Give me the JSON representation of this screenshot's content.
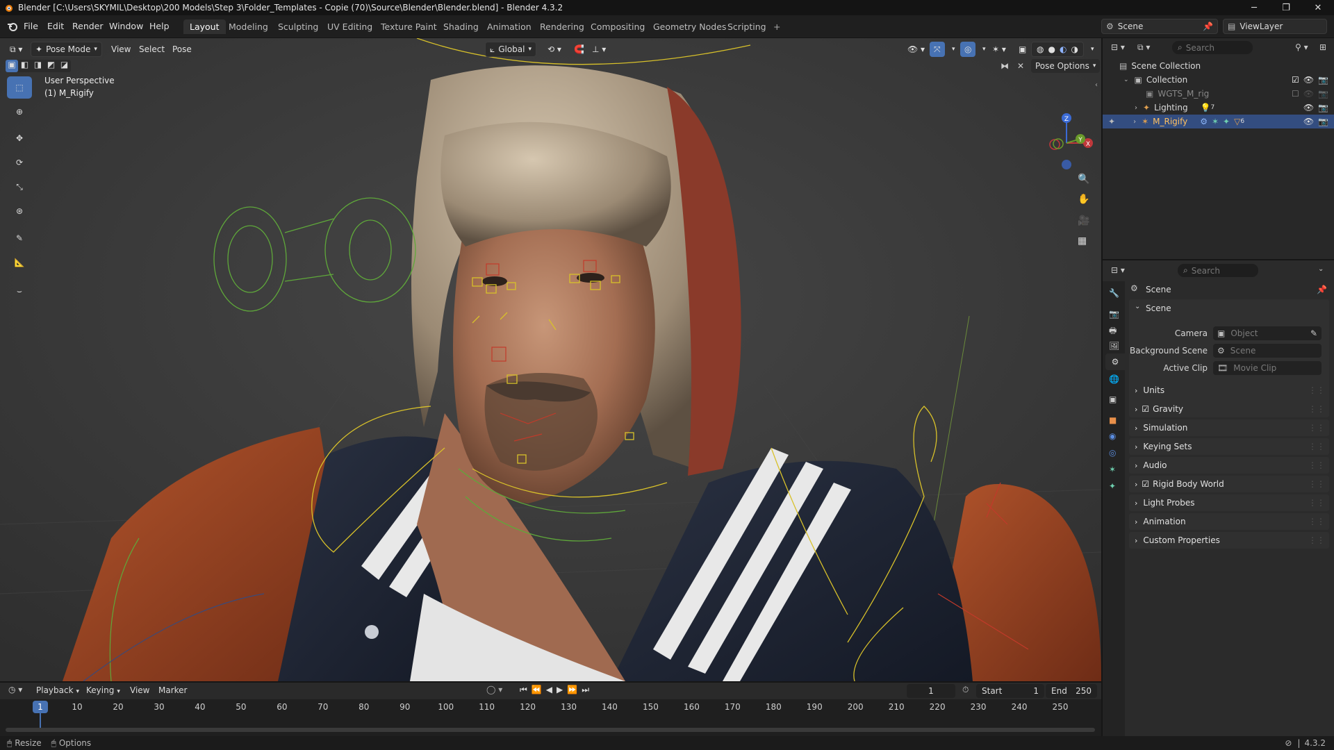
{
  "window": {
    "title": "Blender [C:\\Users\\SKYMIL\\Desktop\\200 Models\\Step 3\\Folder_Templates - Copie (70)\\Source\\Blender\\Blender.blend] - Blender 4.3.2"
  },
  "menu": [
    "File",
    "Edit",
    "Render",
    "Window",
    "Help"
  ],
  "workspaces": [
    "Layout",
    "Modeling",
    "Sculpting",
    "UV Editing",
    "Texture Paint",
    "Shading",
    "Animation",
    "Rendering",
    "Compositing",
    "Geometry Nodes",
    "Scripting"
  ],
  "active_workspace": "Layout",
  "scene_selector": {
    "scene": "Scene",
    "view_layer": "ViewLayer"
  },
  "viewport": {
    "mode": "Pose Mode",
    "header_menus": [
      "View",
      "Select",
      "Pose"
    ],
    "transform_orientation": "Global",
    "pose_options": "Pose Options",
    "overlay_line1": "User Perspective",
    "overlay_line2": "(1) M_Rigify",
    "gizmo": {
      "x": "X",
      "y": "Y",
      "z": "Z"
    }
  },
  "outliner": {
    "search_placeholder": "Search",
    "items": [
      {
        "label": "Scene Collection",
        "indent": 0
      },
      {
        "label": "Collection",
        "indent": 1
      },
      {
        "label": "WGTS_M_rig",
        "indent": 2
      },
      {
        "label": "Lighting",
        "indent": 2,
        "badge": "7"
      },
      {
        "label": "M_Rigify",
        "indent": 2,
        "badge": "6",
        "selected": true
      }
    ]
  },
  "properties": {
    "search_placeholder": "Search",
    "context": "Scene",
    "panel": "Scene",
    "fields": [
      {
        "label": "Camera",
        "placeholder": "Object"
      },
      {
        "label": "Background Scene",
        "placeholder": "Scene"
      },
      {
        "label": "Active Clip",
        "placeholder": "Movie Clip"
      }
    ],
    "sections": [
      {
        "label": "Units",
        "checkbox": false
      },
      {
        "label": "Gravity",
        "checkbox": true
      },
      {
        "label": "Simulation",
        "checkbox": false
      },
      {
        "label": "Keying Sets",
        "checkbox": false
      },
      {
        "label": "Audio",
        "checkbox": false
      },
      {
        "label": "Rigid Body World",
        "checkbox": true
      },
      {
        "label": "Light Probes",
        "checkbox": false
      },
      {
        "label": "Animation",
        "checkbox": false
      },
      {
        "label": "Custom Properties",
        "checkbox": false
      }
    ]
  },
  "timeline": {
    "menus": [
      "Playback",
      "Keying",
      "View",
      "Marker"
    ],
    "current_frame": "1",
    "start_label": "Start",
    "start": "1",
    "end_label": "End",
    "end": "250",
    "ticks": [
      "1",
      "10",
      "20",
      "30",
      "40",
      "50",
      "60",
      "70",
      "80",
      "90",
      "100",
      "110",
      "120",
      "130",
      "140",
      "150",
      "160",
      "170",
      "180",
      "190",
      "200",
      "210",
      "220",
      "230",
      "240",
      "250"
    ]
  },
  "statusbar": {
    "left1": "Resize",
    "left2": "Options",
    "version": "4.3.2"
  },
  "colors": {
    "accent": "#4772b3",
    "selection": "#334d80",
    "bone_yellow": "#d8c12a",
    "bone_green": "#5fa83a"
  }
}
